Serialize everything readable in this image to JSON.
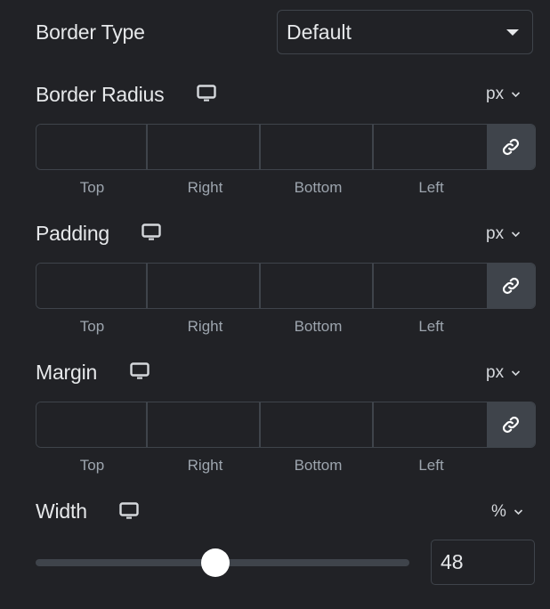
{
  "border_type": {
    "label": "Border Type",
    "selected": "Default"
  },
  "border_radius": {
    "label": "Border Radius",
    "unit": "px",
    "values": {
      "top": "",
      "right": "",
      "bottom": "",
      "left": ""
    },
    "sides": [
      "Top",
      "Right",
      "Bottom",
      "Left"
    ]
  },
  "padding": {
    "label": "Padding",
    "unit": "px",
    "values": {
      "top": "",
      "right": "",
      "bottom": "",
      "left": ""
    },
    "sides": [
      "Top",
      "Right",
      "Bottom",
      "Left"
    ]
  },
  "margin": {
    "label": "Margin",
    "unit": "px",
    "values": {
      "top": "",
      "right": "",
      "bottom": "",
      "left": ""
    },
    "sides": [
      "Top",
      "Right",
      "Bottom",
      "Left"
    ]
  },
  "width": {
    "label": "Width",
    "unit": "%",
    "value": "48",
    "slider_fraction": 0.48
  },
  "icons": {
    "responsive": "monitor-icon",
    "link": "link-icon",
    "dropdown": "caret-down-icon",
    "unit_chevron": "chevron-down-icon"
  }
}
